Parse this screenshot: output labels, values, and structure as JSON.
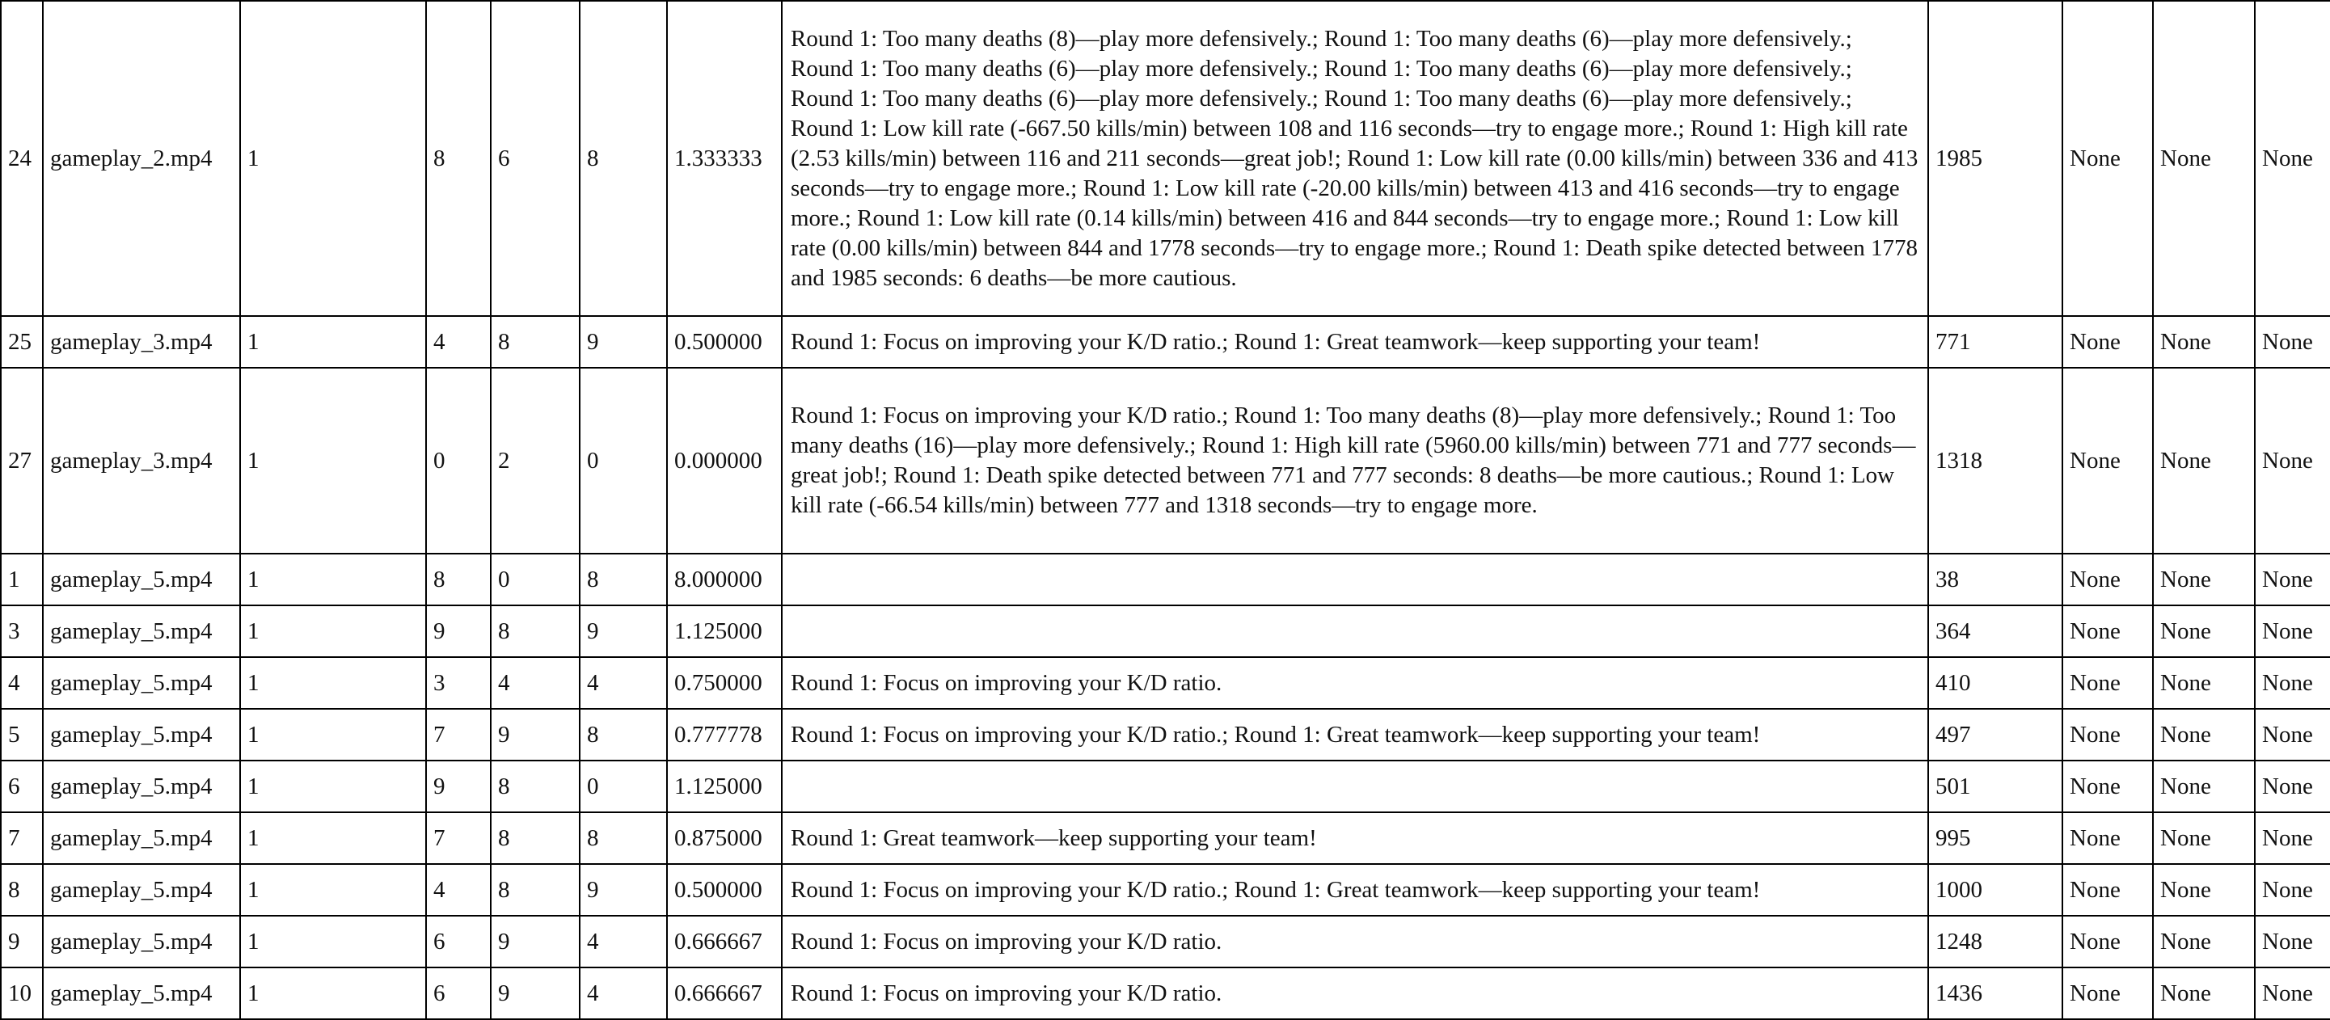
{
  "rows": [
    {
      "idx": "24",
      "file": "gameplay_2.mp4",
      "round": "1",
      "kills": "8",
      "deaths": "6",
      "assists": "8",
      "kd": "1.333333",
      "tips": "Round 1: Too many deaths (8)—play more defensively.; Round 1: Too many deaths (6)—play more defensively.; Round 1: Too many deaths (6)—play more defensively.; Round 1: Too many deaths (6)—play more defensively.; Round 1: Too many deaths (6)—play more defensively.; Round 1: Too many deaths (6)—play more defensively.; Round 1: Low kill rate (-667.50 kills/min) between 108 and 116 seconds—try to engage more.; Round 1: High kill rate (2.53 kills/min) between 116 and 211 seconds—great job!; Round 1: Low kill rate (0.00 kills/min) between 336 and 413 seconds—try to engage more.; Round 1: Low kill rate (-20.00 kills/min) between 413 and 416 seconds—try to engage more.; Round 1: Low kill rate (0.14 kills/min) between 416 and 844 seconds—try to engage more.; Round 1: Low kill rate (0.00 kills/min) between 844 and 1778 seconds—try to engage more.; Round 1: Death spike detected between 1778 and 1985 seconds: 6 deaths—be more cautious.",
      "time": "1985",
      "c1": "None",
      "c2": "None",
      "c3": "None"
    },
    {
      "idx": "25",
      "file": "gameplay_3.mp4",
      "round": "1",
      "kills": "4",
      "deaths": "8",
      "assists": "9",
      "kd": "0.500000",
      "tips": "Round 1: Focus on improving your K/D ratio.; Round 1: Great teamwork—keep supporting your team!",
      "time": "771",
      "c1": "None",
      "c2": "None",
      "c3": "None"
    },
    {
      "idx": "27",
      "file": "gameplay_3.mp4",
      "round": "1",
      "kills": "0",
      "deaths": "2",
      "assists": "0",
      "kd": "0.000000",
      "tips": "Round 1: Focus on improving your K/D ratio.; Round 1: Too many deaths (8)—play more defensively.; Round 1: Too many deaths (16)—play more defensively.; Round 1: High kill rate (5960.00 kills/min) between 771 and 777 seconds—great job!; Round 1: Death spike detected between 771 and 777 seconds: 8 deaths—be more cautious.; Round 1: Low kill rate (-66.54 kills/min) between 777 and 1318 seconds—try to engage more.",
      "time": "1318",
      "c1": "None",
      "c2": "None",
      "c3": "None"
    },
    {
      "idx": "1",
      "file": "gameplay_5.mp4",
      "round": "1",
      "kills": "8",
      "deaths": "0",
      "assists": "8",
      "kd": "8.000000",
      "tips": "",
      "time": "38",
      "c1": "None",
      "c2": "None",
      "c3": "None"
    },
    {
      "idx": "3",
      "file": "gameplay_5.mp4",
      "round": "1",
      "kills": "9",
      "deaths": "8",
      "assists": "9",
      "kd": "1.125000",
      "tips": "",
      "time": "364",
      "c1": "None",
      "c2": "None",
      "c3": "None"
    },
    {
      "idx": "4",
      "file": "gameplay_5.mp4",
      "round": "1",
      "kills": "3",
      "deaths": "4",
      "assists": "4",
      "kd": "0.750000",
      "tips": "Round 1: Focus on improving your K/D ratio.",
      "time": "410",
      "c1": "None",
      "c2": "None",
      "c3": "None"
    },
    {
      "idx": "5",
      "file": "gameplay_5.mp4",
      "round": "1",
      "kills": "7",
      "deaths": "9",
      "assists": "8",
      "kd": "0.777778",
      "tips": "Round 1: Focus on improving your K/D ratio.; Round 1: Great teamwork—keep supporting your team!",
      "time": "497",
      "c1": "None",
      "c2": "None",
      "c3": "None"
    },
    {
      "idx": "6",
      "file": "gameplay_5.mp4",
      "round": "1",
      "kills": "9",
      "deaths": "8",
      "assists": "0",
      "kd": "1.125000",
      "tips": "",
      "time": "501",
      "c1": "None",
      "c2": "None",
      "c3": "None"
    },
    {
      "idx": "7",
      "file": "gameplay_5.mp4",
      "round": "1",
      "kills": "7",
      "deaths": "8",
      "assists": "8",
      "kd": "0.875000",
      "tips": "Round 1: Great teamwork—keep supporting your team!",
      "time": "995",
      "c1": "None",
      "c2": "None",
      "c3": "None"
    },
    {
      "idx": "8",
      "file": "gameplay_5.mp4",
      "round": "1",
      "kills": "4",
      "deaths": "8",
      "assists": "9",
      "kd": "0.500000",
      "tips": "Round 1: Focus on improving your K/D ratio.; Round 1: Great teamwork—keep supporting your team!",
      "time": "1000",
      "c1": "None",
      "c2": "None",
      "c3": "None"
    },
    {
      "idx": "9",
      "file": "gameplay_5.mp4",
      "round": "1",
      "kills": "6",
      "deaths": "9",
      "assists": "4",
      "kd": "0.666667",
      "tips": "Round 1: Focus on improving your K/D ratio.",
      "time": "1248",
      "c1": "None",
      "c2": "None",
      "c3": "None"
    },
    {
      "idx": "10",
      "file": "gameplay_5.mp4",
      "round": "1",
      "kills": "6",
      "deaths": "9",
      "assists": "4",
      "kd": "0.666667",
      "tips": "Round 1: Focus on improving your K/D ratio.",
      "time": "1436",
      "c1": "None",
      "c2": "None",
      "c3": "None"
    }
  ]
}
